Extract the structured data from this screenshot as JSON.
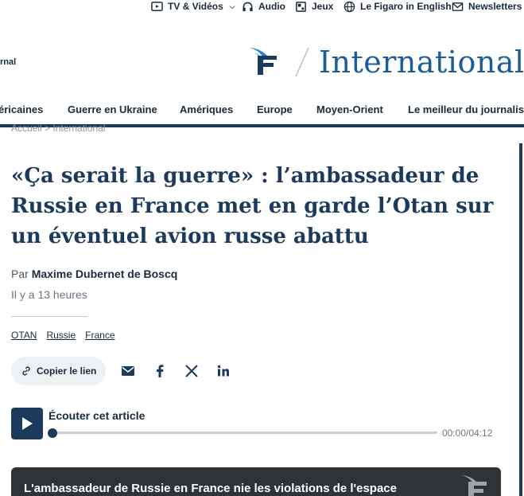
{
  "topbar": {
    "items": [
      {
        "label": "TV & Vidéos",
        "icon": "tv-icon",
        "dropdown": true
      },
      {
        "label": "Audio",
        "icon": "headphones-icon",
        "dropdown": false
      },
      {
        "label": "Jeux",
        "icon": "puzzle-icon",
        "dropdown": false
      },
      {
        "label": "Le Figaro in English",
        "icon": "globe-icon",
        "dropdown": false
      },
      {
        "label": "Newsletters",
        "icon": "mail-icon",
        "dropdown": true
      }
    ]
  },
  "header": {
    "left_fragment": "rnal",
    "logo": "le-figaro-logo",
    "section": "International"
  },
  "nav": {
    "items": [
      "éricaines",
      "Guerre en Ukraine",
      "Amériques",
      "Europe",
      "Moyen-Orient",
      "Le meilleur du journalisme"
    ]
  },
  "breadcrumb": "Accueil > International",
  "article": {
    "headline": "«Ça serait la guerre» : l’ambassadeur de Russie en France met en garde l’Otan sur un éventuel avion russe abattu",
    "by_prefix": "Par",
    "author": "Maxime Dubernet de Boscq",
    "date": "Il y a 13 heures",
    "tags": [
      "OTAN",
      "Russie",
      "France"
    ]
  },
  "share": {
    "copy_label": "Copier le lien",
    "icons": [
      "email-icon",
      "facebook-icon",
      "x-icon",
      "linkedin-icon"
    ]
  },
  "audio": {
    "title": "Écouter cet article",
    "time": "00:00/04:12",
    "progress": 0
  },
  "video": {
    "title": "L'ambassadeur de Russie en France nie les violations de l'espace"
  },
  "colors": {
    "brand_blue": "#1c5c99",
    "navy": "#1b3a5c",
    "text": "#1b2a3a"
  }
}
